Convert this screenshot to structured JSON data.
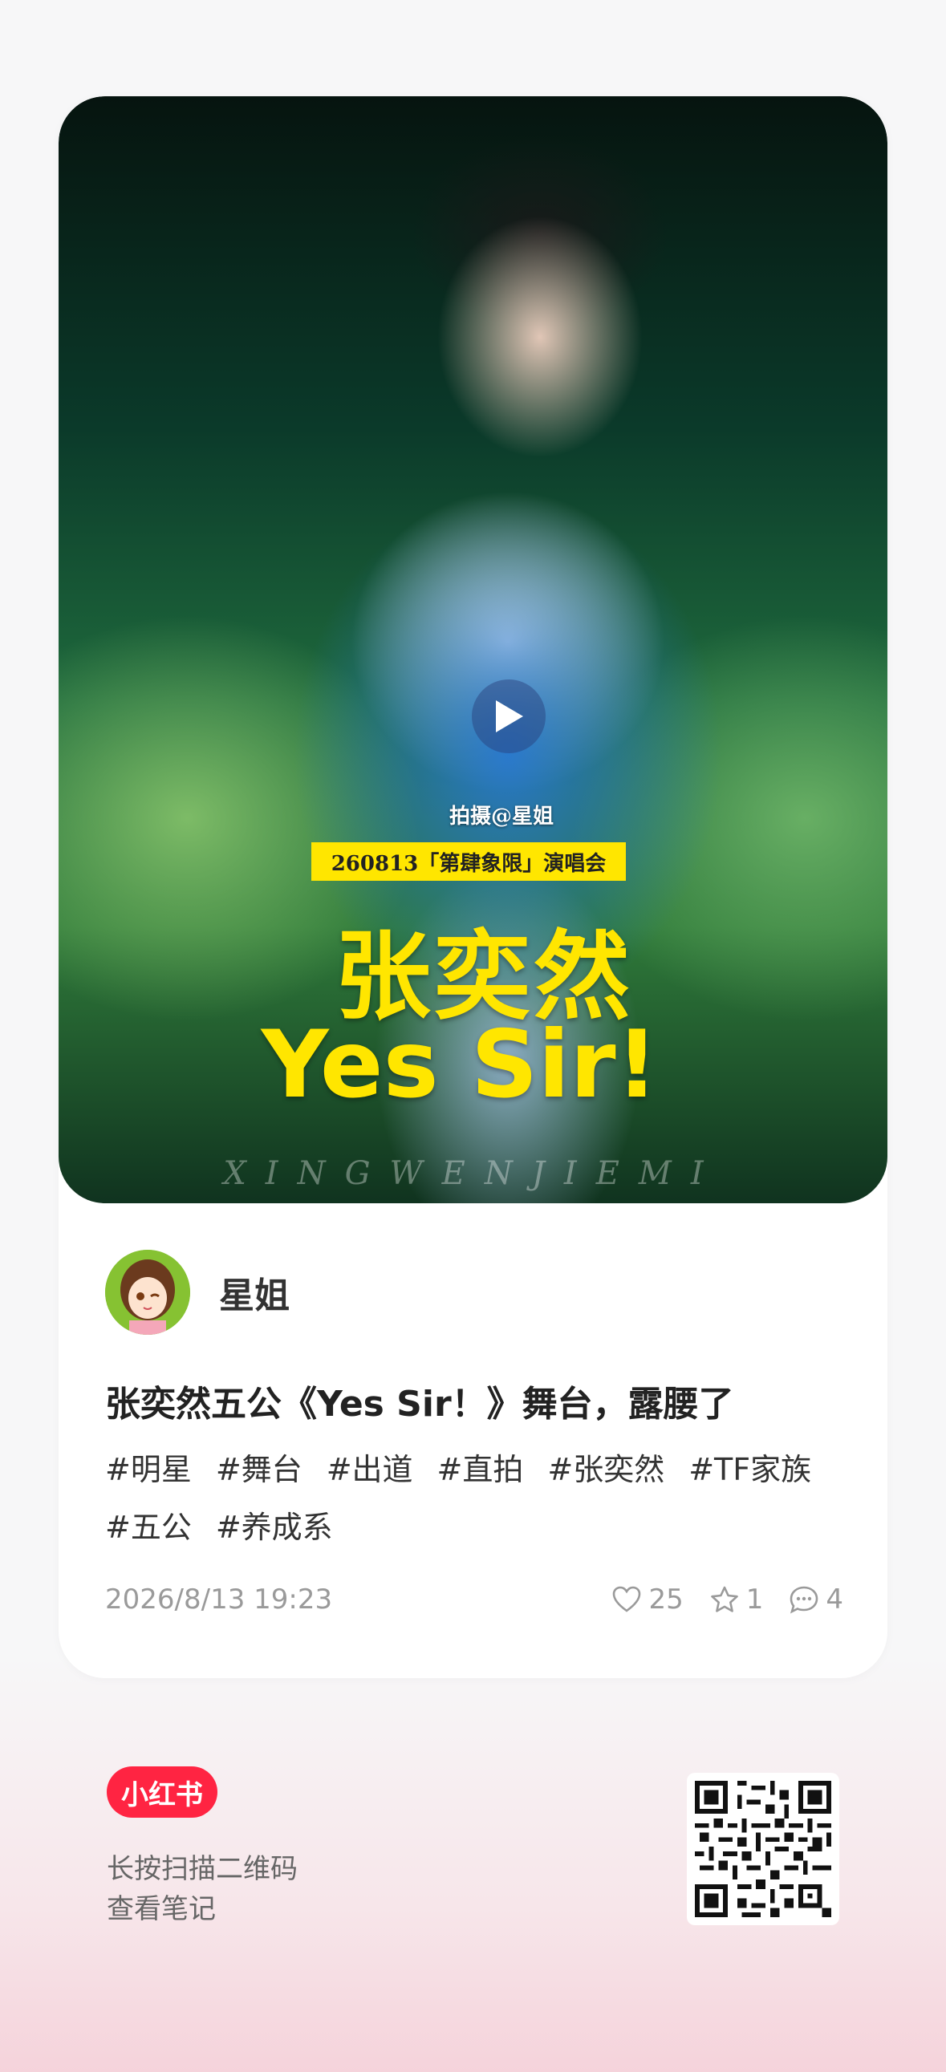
{
  "post": {
    "media": {
      "credit": "拍摄@星姐",
      "event_banner": "260813「第肆象限」演唱会",
      "overlay_name": "张奕然",
      "overlay_song": "Yes Sir!",
      "watermark": "XINGWENJIEMI"
    },
    "author": {
      "name": "星姐"
    },
    "title": "张奕然五公《Yes Sir！》舞台，露腰了",
    "tags": [
      "#明星",
      "#舞台",
      "#出道",
      "#直拍",
      "#张奕然",
      "#TF家族",
      "#五公",
      "#养成系"
    ],
    "timestamp": "2026/8/13 19:23",
    "likes": "25",
    "collects": "1",
    "comments": "4"
  },
  "footer": {
    "logo": "小红书",
    "line1": "长按扫描二维码",
    "line2": "查看笔记"
  },
  "icons": [
    "play-icon",
    "heart-icon",
    "star-icon",
    "comment-icon",
    "qr-code-icon"
  ],
  "colors": {
    "brand": "#ff2442",
    "highlight": "#ffe600"
  }
}
